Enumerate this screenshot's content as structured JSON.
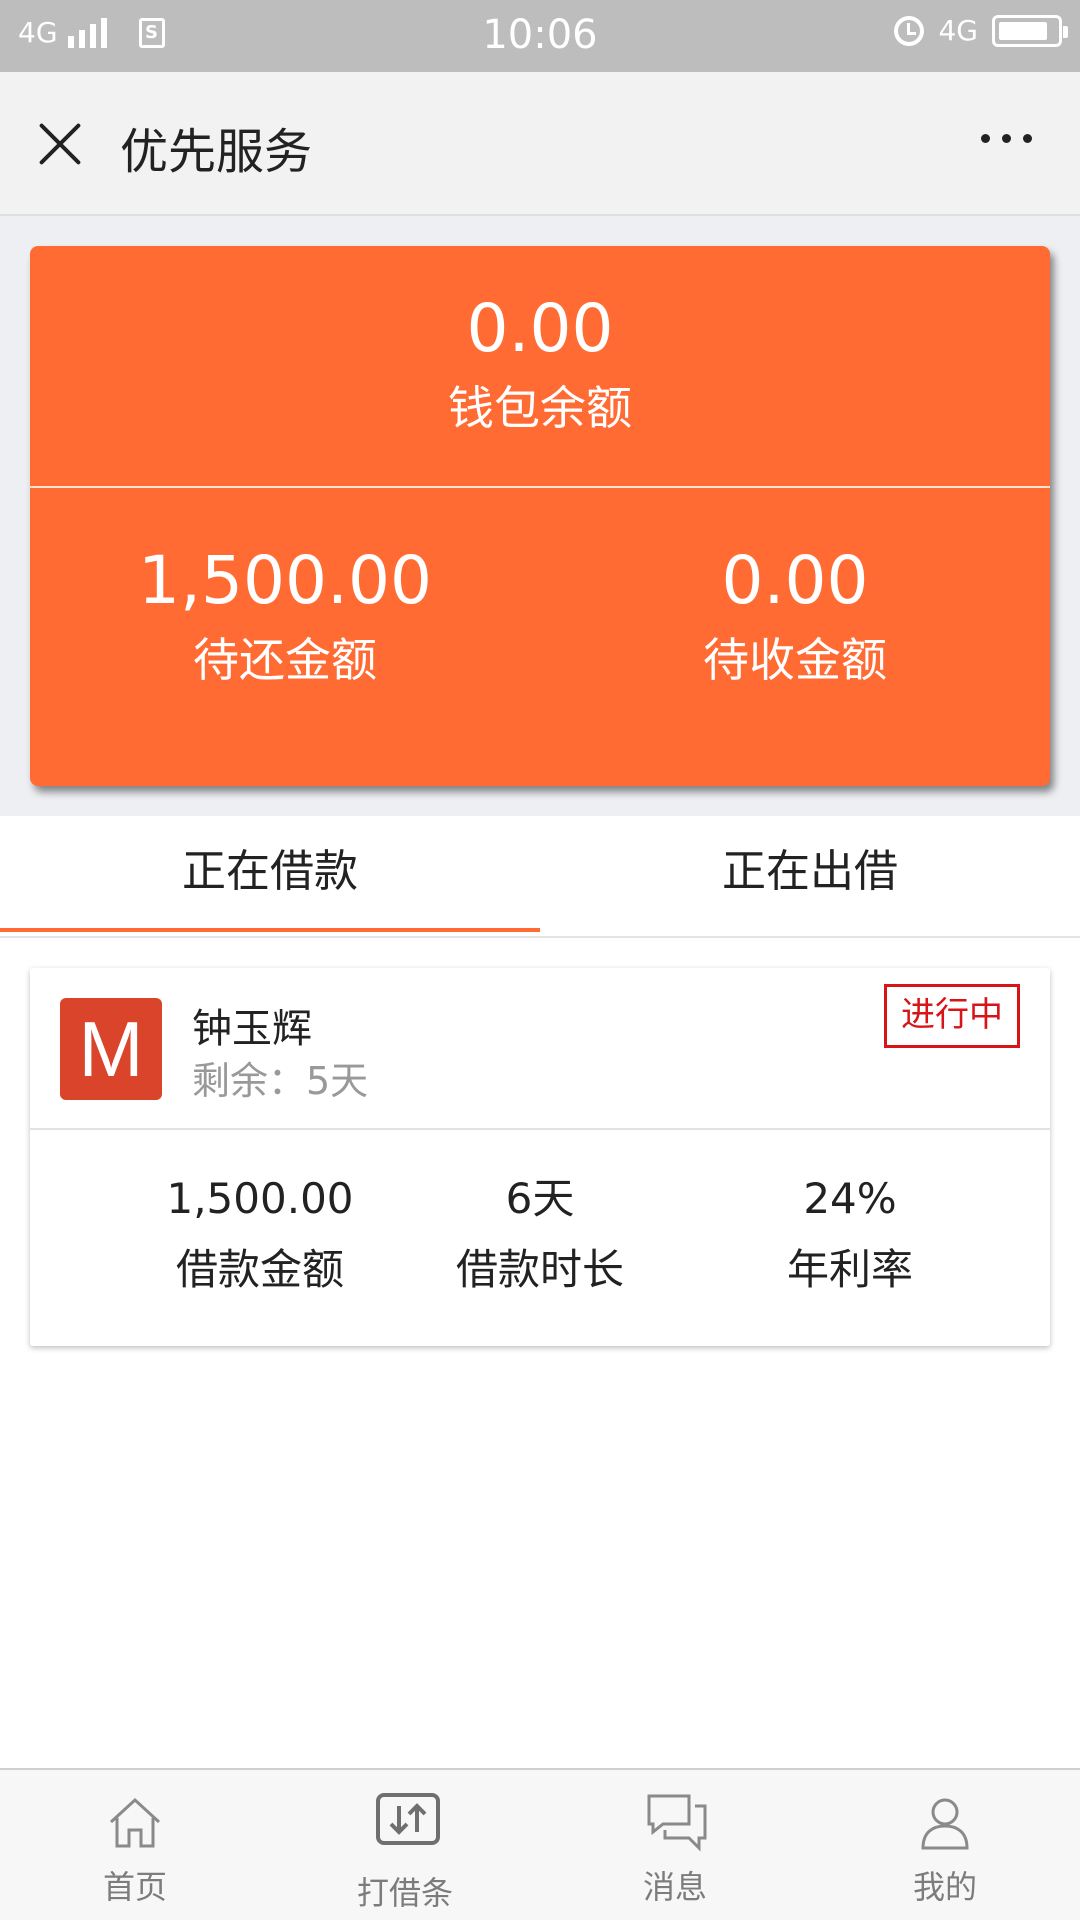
{
  "status_bar": {
    "network_left": "4G",
    "time": "10:06",
    "network_right": "4G"
  },
  "header": {
    "title": "优先服务"
  },
  "summary": {
    "wallet_balance": "0.00",
    "wallet_label": "钱包余额",
    "to_repay_amount": "1,500.00",
    "to_repay_label": "待还金额",
    "to_receive_amount": "0.00",
    "to_receive_label": "待收金额"
  },
  "tabs": [
    {
      "label": "正在借款",
      "active": true
    },
    {
      "label": "正在出借",
      "active": false
    }
  ],
  "loan": {
    "avatar_letter": "M",
    "lender_name": "钟玉辉",
    "remaining": "剩余：5天",
    "status": "进行中",
    "amount": "1,500.00",
    "amount_label": "借款金额",
    "duration": "6天",
    "duration_label": "借款时长",
    "rate": "24%",
    "rate_label": "年利率"
  },
  "bottom_nav": [
    {
      "label": "首页",
      "icon": "home-icon"
    },
    {
      "label": "打借条",
      "icon": "transfer-icon"
    },
    {
      "label": "消息",
      "icon": "message-icon"
    },
    {
      "label": "我的",
      "icon": "user-icon"
    }
  ],
  "colors": {
    "accent": "#ff6b33",
    "badge_red": "#d71518",
    "avatar_bg": "#d9442b"
  }
}
